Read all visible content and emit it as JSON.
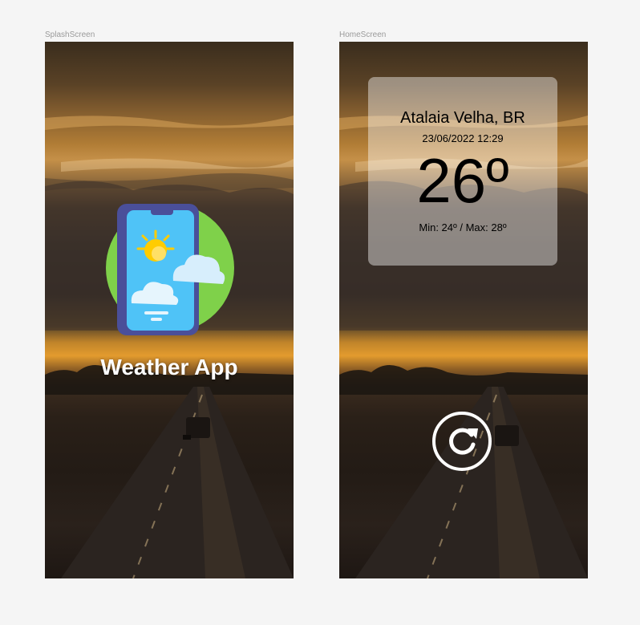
{
  "frames": {
    "splash": {
      "label": "SplashScreen"
    },
    "home": {
      "label": "HomeScreen"
    }
  },
  "splash": {
    "app_name": "Weather App",
    "logo_icon": "weather-app-phone-sun-cloud-icon",
    "logo_colors": {
      "circle": "#7fd14a",
      "phone_body": "#4a4f9a",
      "screen": "#4fc3f7",
      "sun": "#ffcc00"
    }
  },
  "home": {
    "city": "Atalaia Velha, BR",
    "datetime": "23/06/2022 12:29",
    "temperature": "26º",
    "min_max": "Min: 24º / Max: 28º",
    "refresh_icon": "refresh-icon"
  }
}
